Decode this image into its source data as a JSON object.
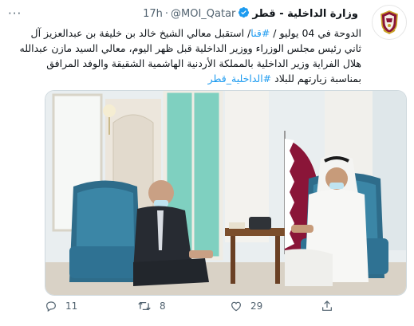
{
  "tweet": {
    "display_name": "وزارة الداخلية - قطر",
    "handle": "@MOI_Qatar",
    "separator": "·",
    "time": "17h",
    "more_menu": "···",
    "text_lines": [
      {
        "parts": [
          {
            "text": "الدوحة في 04 يوليو / ",
            "link": false
          },
          {
            "text": "#قنا",
            "link": true
          },
          {
            "text": "/ استقبل معالي الشيخ خالد بن خليفة بن عبدالعزيز آل",
            "link": false
          }
        ]
      },
      {
        "parts": [
          {
            "text": "ثاني رئيس مجلس الوزراء ووزير الداخلية قبل ظهر اليوم، معالي السيد مازن عبدالله",
            "link": false
          }
        ]
      },
      {
        "parts": [
          {
            "text": "هلال الفراية وزير الداخلية بالمملكة الأردنية الهاشمية الشقيقة والوفد المرافق",
            "link": false
          }
        ]
      },
      {
        "parts": [
          {
            "text": "بمناسبة زيارتهم للبلاد ",
            "link": false
          },
          {
            "text": "#الداخلية_قطر",
            "link": true
          }
        ]
      }
    ],
    "image": {
      "description_icon": "photo"
    },
    "actions": {
      "replies": "11",
      "retweets": "8",
      "likes": "29"
    }
  },
  "colors": {
    "link": "#1d9bf0",
    "secondary_text": "#536471",
    "verified": "#1d9bf0",
    "flag_maroon": "#8a1538"
  },
  "icons": [
    "more-icon",
    "verified-icon",
    "avatar-logo",
    "reply-icon",
    "retweet-icon",
    "like-icon",
    "share-icon"
  ]
}
